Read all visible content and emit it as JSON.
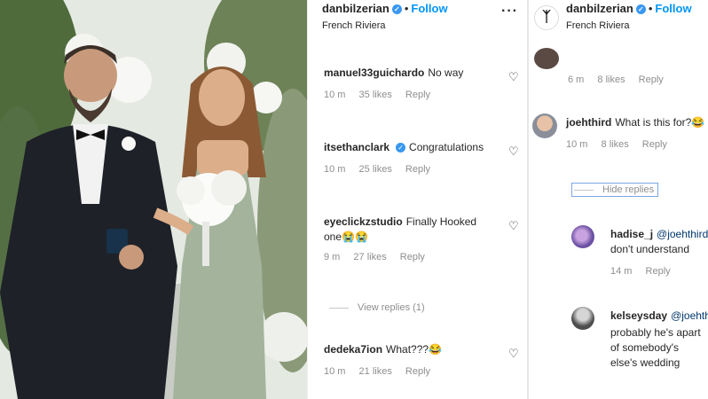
{
  "post": {
    "username": "danbilzerian",
    "follow_label": "Follow",
    "location": "French Riviera",
    "more_icon": "more-horizontal-icon",
    "verified_icon": "verified-badge-icon"
  },
  "middle_comments": [
    {
      "user": "manuel33guichardo",
      "verified": false,
      "text": "No way",
      "time": "10 m",
      "likes": "35 likes",
      "reply": "Reply"
    },
    {
      "user": "itsethanclark",
      "verified": true,
      "text": "Congratulations",
      "time": "10 m",
      "likes": "25 likes",
      "reply": "Reply"
    },
    {
      "user": "eyeclickzstudio",
      "verified": false,
      "text": "Finally Hooked one😭😭",
      "time": "9 m",
      "likes": "27 likes",
      "reply": "Reply",
      "view_replies": "View replies (1)"
    },
    {
      "user": "dedeka7ion",
      "verified": false,
      "text": "What???😂",
      "time": "10 m",
      "likes": "21 likes",
      "reply": "Reply"
    }
  ],
  "right_panel": {
    "top_meta": {
      "time": "6 m",
      "likes": "8 likes",
      "reply": "Reply"
    },
    "main_comment": {
      "user": "joehthird",
      "text": "What is this for?😂",
      "time": "10 m",
      "likes": "8 likes",
      "reply": "Reply"
    },
    "hide_replies": "Hide replies",
    "replies": [
      {
        "user": "hadise_j",
        "mention": "@joehthird",
        "text": "don't understand",
        "time": "14 m",
        "reply": "Reply"
      },
      {
        "user": "kelseysday",
        "mention": "@joehth",
        "text": "probably he's apart of somebody's else's wedding"
      }
    ]
  },
  "colors": {
    "accent": "#0095f6",
    "verified": "#3897f0",
    "meta": "#8e8e8e",
    "dress": "#a3b39c",
    "tuxedo": "#1e2128"
  }
}
